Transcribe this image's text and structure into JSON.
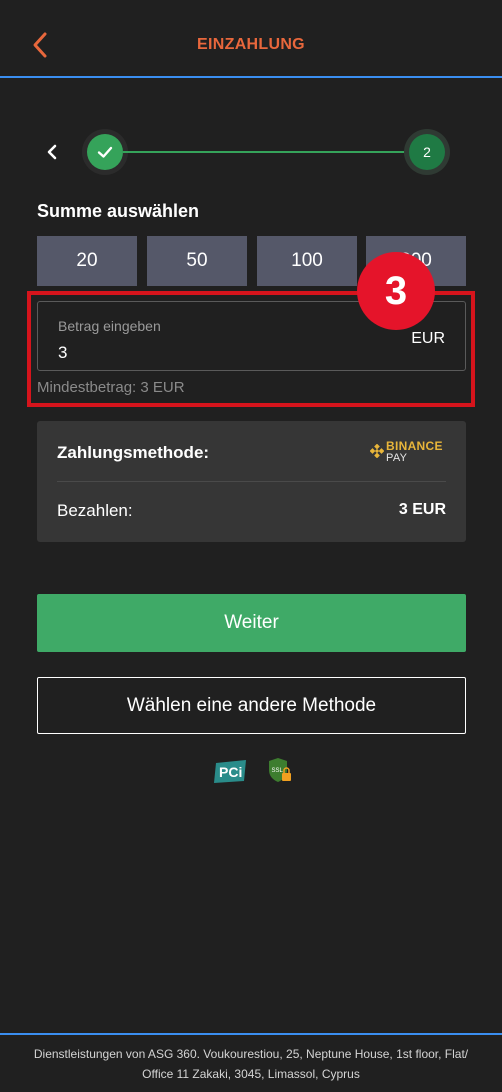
{
  "header": {
    "title": "EINZAHLUNG"
  },
  "stepper": {
    "step2_label": "2",
    "colors": {
      "done": "#35a35a",
      "current": "#1f7a44"
    }
  },
  "amount_section": {
    "title": "Summe auswählen",
    "presets": [
      "20",
      "50",
      "100",
      "200"
    ],
    "input": {
      "label": "Betrag eingeben",
      "value": "3",
      "currency": "EUR"
    },
    "minimum": "Mindestbetrag: 3 EUR"
  },
  "annotation": {
    "marker": "3",
    "color": "#e5142a"
  },
  "summary": {
    "method_label": "Zahlungsmethode:",
    "method_logo": {
      "line1": "BINANCE",
      "line2": "PAY"
    },
    "pay_label": "Bezahlen:",
    "pay_value": "3 EUR"
  },
  "actions": {
    "continue": "Weiter",
    "other_method": "Wählen eine andere Methode"
  },
  "badges": {
    "pci": "PCi",
    "ssl": "SSL"
  },
  "footer": {
    "line1": "Dienstleistungen von ASG 360. Voukourestiou, 25, Neptune House, 1st floor, Flat/",
    "line2": "Office 11 Zakaki, 3045, Limassol, Cyprus"
  },
  "icons": [
    "chevron-left-icon",
    "checkmark-icon",
    "binance-icon",
    "pci-badge-icon",
    "ssl-shield-icon"
  ],
  "colors": {
    "accent": "#e8673c",
    "primary_button": "#3faa67",
    "divider": "#3a8ef0",
    "preset_bg": "#555869"
  }
}
